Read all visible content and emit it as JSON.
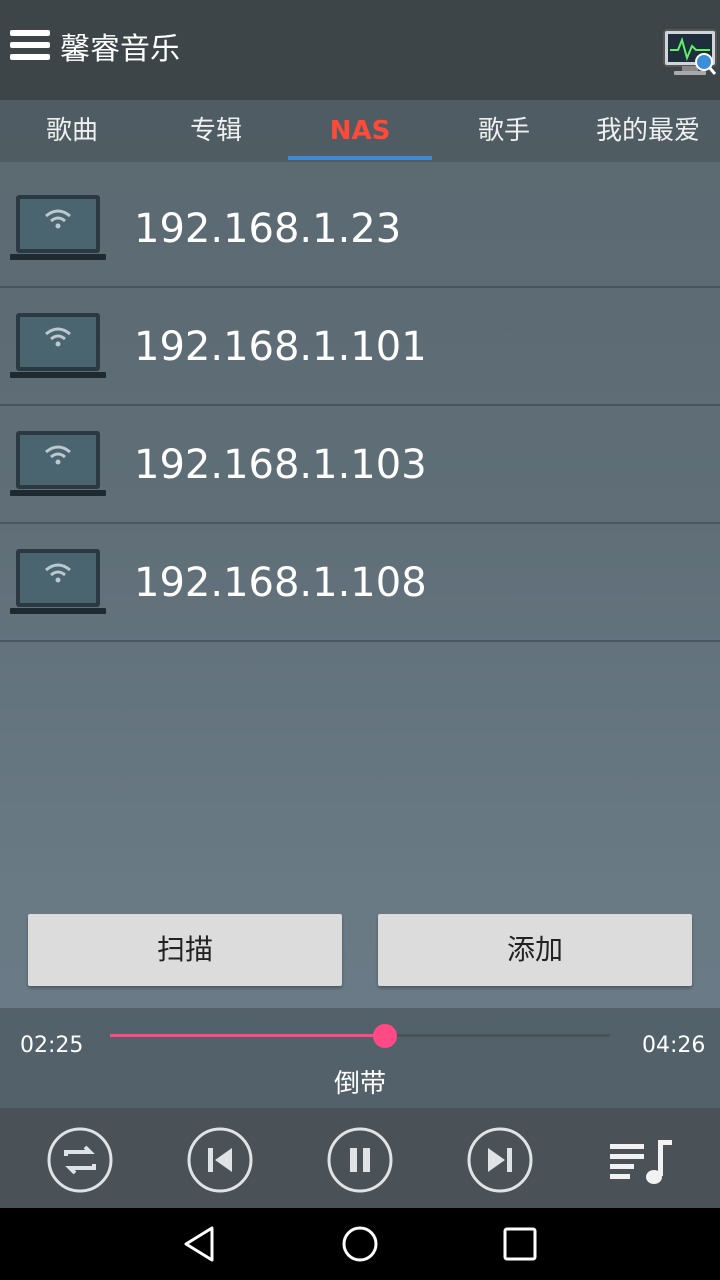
{
  "app_bar": {
    "title": "馨睿音乐",
    "menu_icon": "hamburger-menu-icon",
    "right_icon": "monitor-icon"
  },
  "tabs": [
    {
      "label": "歌曲",
      "active": false
    },
    {
      "label": "专辑",
      "active": false
    },
    {
      "label": "NAS",
      "active": true
    },
    {
      "label": "歌手",
      "active": false
    },
    {
      "label": "我的最爱",
      "active": false
    }
  ],
  "nas_devices": [
    {
      "ip": "192.168.1.23"
    },
    {
      "ip": "192.168.1.101"
    },
    {
      "ip": "192.168.1.103"
    },
    {
      "ip": "192.168.1.108"
    }
  ],
  "buttons": {
    "scan": "扫描",
    "add": "添加"
  },
  "player": {
    "elapsed": "02:25",
    "duration": "04:26",
    "progress_fraction": 0.55,
    "song_title": "倒带"
  },
  "controls": [
    "repeat-icon",
    "previous-icon",
    "pause-icon",
    "next-icon",
    "playlist-icon"
  ],
  "colors": {
    "accent_active_tab": "#ff4a3a",
    "tab_indicator": "#3d8ad6",
    "progress": "#ff4a86"
  }
}
